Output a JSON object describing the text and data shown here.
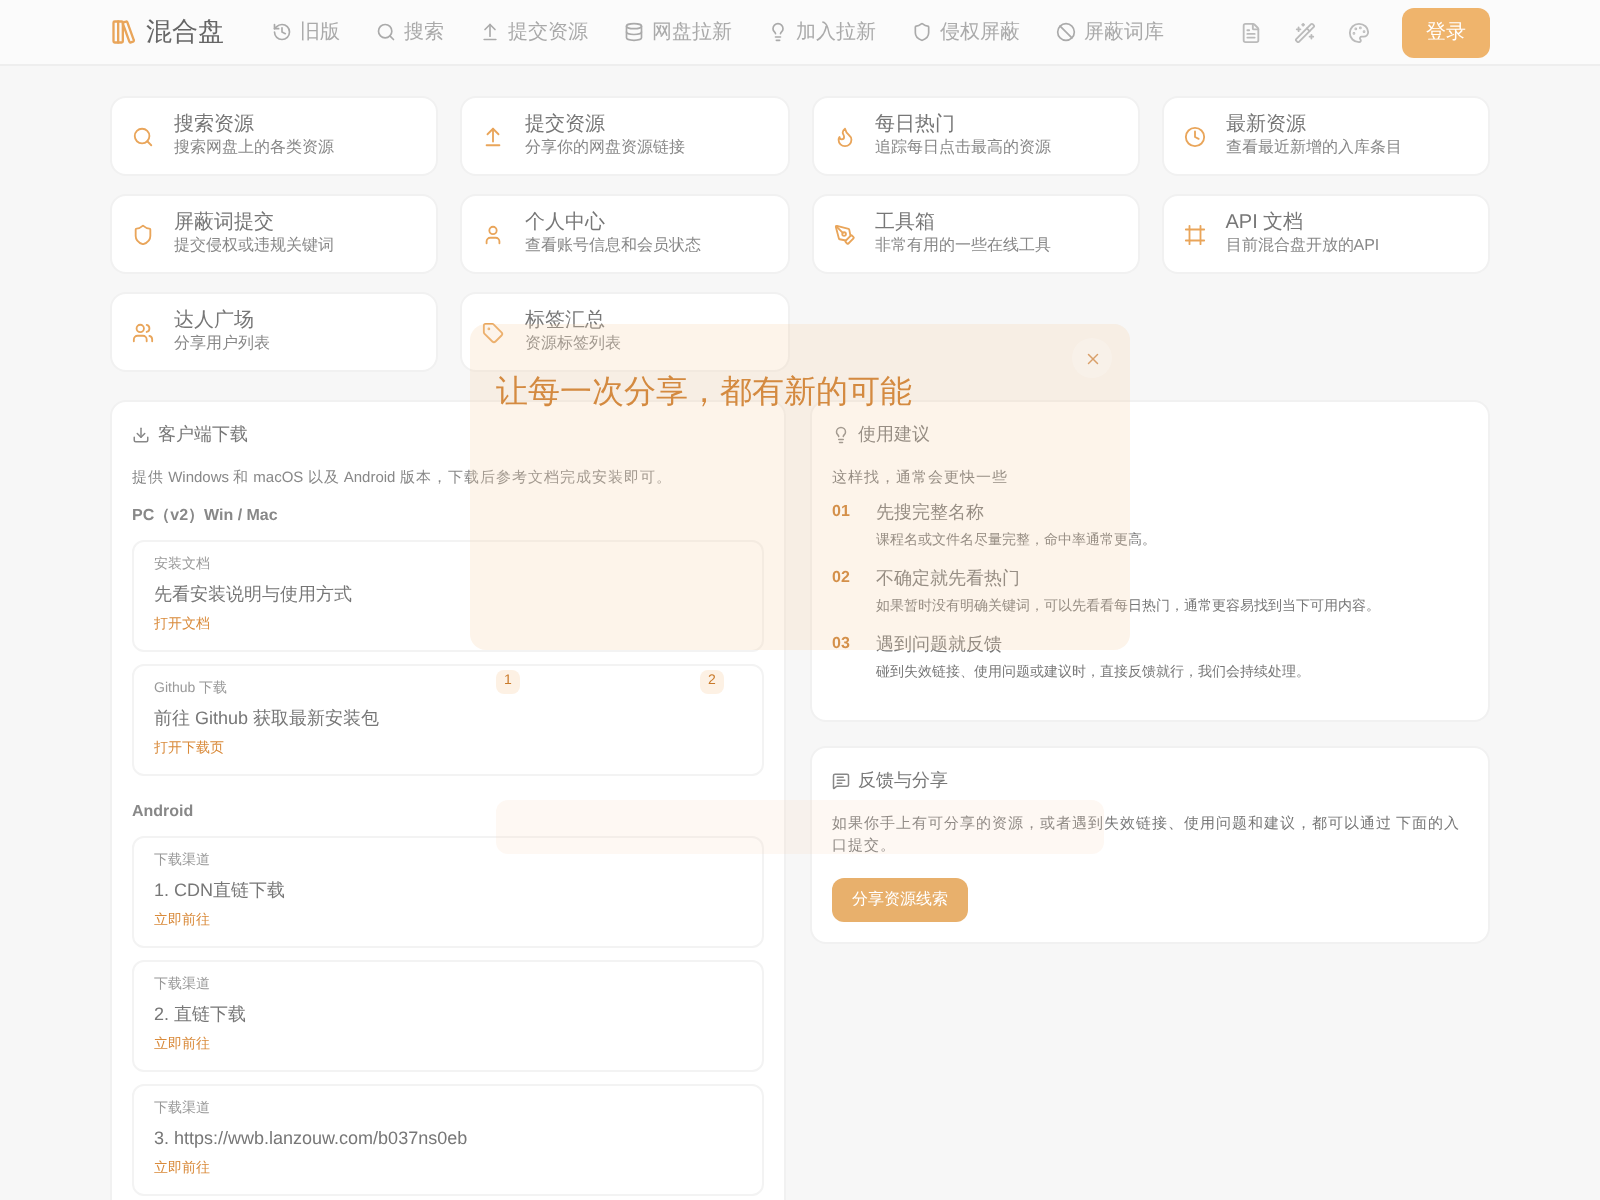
{
  "header": {
    "logo": "混合盘",
    "nav": [
      {
        "label": "旧版"
      },
      {
        "label": "搜索"
      },
      {
        "label": "提交资源"
      },
      {
        "label": "网盘拉新"
      },
      {
        "label": "加入拉新"
      },
      {
        "label": "侵权屏蔽"
      },
      {
        "label": "屏蔽词库"
      }
    ],
    "login": "登录"
  },
  "shortcuts": [
    {
      "title": "搜索资源",
      "desc": "搜索网盘上的各类资源"
    },
    {
      "title": "提交资源",
      "desc": "分享你的网盘资源链接"
    },
    {
      "title": "每日热门",
      "desc": "追踪每日点击最高的资源"
    },
    {
      "title": "最新资源",
      "desc": "查看最近新增的入库条目"
    },
    {
      "title": "屏蔽词提交",
      "desc": "提交侵权或违规关键词"
    },
    {
      "title": "个人中心",
      "desc": "查看账号信息和会员状态"
    },
    {
      "title": "工具箱",
      "desc": "非常有用的一些在线工具"
    },
    {
      "title": "API 文档",
      "desc": "目前混合盘开放的API"
    },
    {
      "title": "达人广场",
      "desc": "分享用户列表"
    },
    {
      "title": "标签汇总",
      "desc": "资源标签列表"
    }
  ],
  "download": {
    "title": "客户端下载",
    "intro": "提供 Windows 和 macOS 以及 Android 版本，下载后参考文档完成安装即可。",
    "groups": [
      {
        "heading": "PC（v2）Win / Mac",
        "items": [
          {
            "label": "安装文档",
            "title": "先看安装说明与使用方式",
            "link": "打开文档"
          },
          {
            "label": "Github 下载",
            "title": "前往 Github 获取最新安装包",
            "link": "打开下载页"
          }
        ]
      },
      {
        "heading": "Android",
        "items": [
          {
            "label": "下载渠道",
            "title": "1. CDN直链下载",
            "link": "立即前往"
          },
          {
            "label": "下载渠道",
            "title": "2. 直链下载",
            "link": "立即前往"
          },
          {
            "label": "下载渠道",
            "title": "3. https://wwb.lanzouw.com/b037ns0eb",
            "link": "立即前往"
          }
        ]
      }
    ]
  },
  "tips": {
    "title": "使用建议",
    "subtitle": "这样找，通常会更快一些",
    "items": [
      {
        "num": "01",
        "title": "先搜完整名称",
        "desc": "课程名或文件名尽量完整，命中率通常更高。"
      },
      {
        "num": "02",
        "title": "不确定就先看热门",
        "desc": "如果暂时没有明确关键词，可以先看看每日热门，通常更容易找到当下可用内容。"
      },
      {
        "num": "03",
        "title": "遇到问题就反馈",
        "desc": "碰到失效链接、使用问题或建议时，直接反馈就行，我们会持续处理。"
      }
    ]
  },
  "feedback": {
    "title": "反馈与分享",
    "text": "如果你手上有可分享的资源，或者遇到失效链接、使用问题和建议，都可以通过 下面的入口提交。",
    "button": "分享资源线索"
  },
  "modal": {
    "headline": "让每一次分享，都有新的可能",
    "steps": [
      "1",
      "2"
    ]
  }
}
